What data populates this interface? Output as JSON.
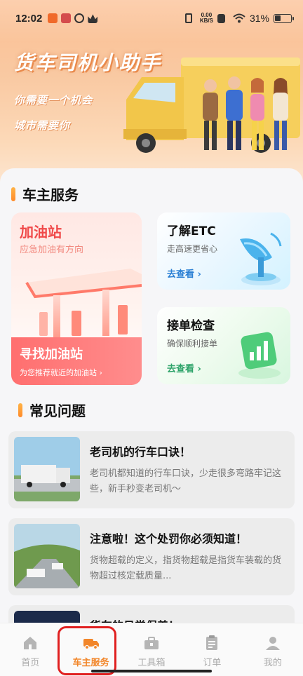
{
  "status_bar": {
    "time": "12:02",
    "network_speed": "0.00",
    "network_unit": "KB/S",
    "battery": "31%"
  },
  "banner": {
    "title": "货车司机小助手",
    "subtitle1": "你需要一个机会",
    "subtitle2": "城市需要你"
  },
  "owner_services": {
    "section_title": "车主服务",
    "gas": {
      "title": "加油站",
      "subtitle": "应急加油有方向",
      "button_title": "寻找加油站",
      "button_sub": "为您推荐就近的加油站 ›"
    },
    "etc": {
      "title": "了解ETC",
      "subtitle": "走高速更省心",
      "link": "去查看 ›"
    },
    "order_check": {
      "title": "接单检查",
      "subtitle": "确保顺利接单",
      "link": "去查看 ›"
    }
  },
  "faq": {
    "section_title": "常见问题",
    "items": [
      {
        "title": "老司机的行车口诀！",
        "desc": "老司机都知道的行车口诀，少走很多弯路牢记这些，新手秒变老司机～"
      },
      {
        "title": "注意啦！这个处罚你必须知道！",
        "desc": "货物超载的定义，指货物超载是指货车装载的货物超过核定载质量..."
      },
      {
        "title": "货车的日常保养！",
        "desc": ""
      }
    ]
  },
  "bottom_nav": {
    "items": [
      {
        "label": "首页",
        "icon": "home-icon"
      },
      {
        "label": "车主服务",
        "icon": "truck-icon"
      },
      {
        "label": "工具箱",
        "icon": "toolbox-icon"
      },
      {
        "label": "订单",
        "icon": "clipboard-icon"
      },
      {
        "label": "我的",
        "icon": "person-icon"
      }
    ],
    "active": "车主服务"
  },
  "colors": {
    "accent": "#f2862a",
    "gas_red": "#f04a4a",
    "etc_blue": "#2a7fd4",
    "check_green": "#2ea36a"
  }
}
